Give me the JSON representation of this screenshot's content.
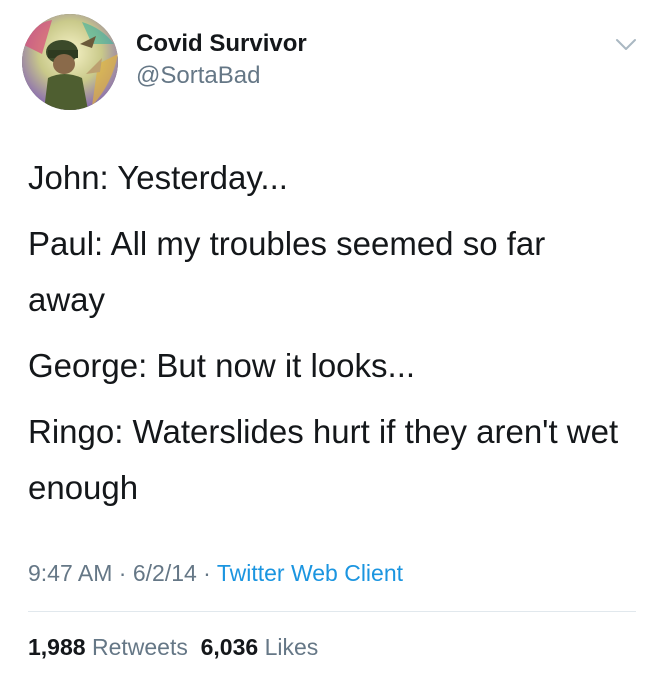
{
  "author": {
    "name": "Covid Survivor",
    "handle": "@SortaBad"
  },
  "icons": {
    "menu": "chevron-down-icon",
    "avatar": "profile-photo"
  },
  "tweet": {
    "lines": [
      "John: Yesterday...",
      "Paul: All my troubles seemed so far away",
      "George: But now it looks...",
      "Ringo: Waterslides hurt if they aren't wet enough"
    ]
  },
  "meta": {
    "time": "9:47 AM",
    "sep1": " · ",
    "date": "6/2/14",
    "sep2": " · ",
    "client": "Twitter Web Client"
  },
  "stats": {
    "retweets_count": "1,988",
    "retweets_label": "Retweets",
    "likes_count": "6,036",
    "likes_label": "Likes"
  },
  "colors": {
    "text": "#14171a",
    "secondary": "#657786",
    "link": "#1b95e0",
    "divider": "#e1e8ed"
  }
}
